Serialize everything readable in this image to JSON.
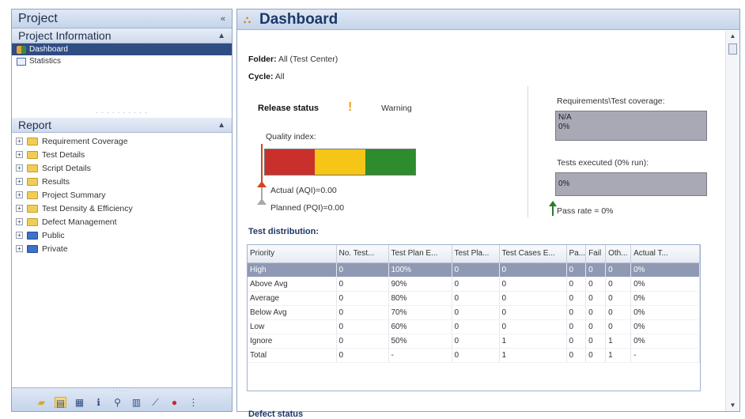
{
  "left_panel": {
    "title": "Project",
    "collapse_label": "«",
    "project_information": {
      "title": "Project Information",
      "collapse_label": "▲",
      "items": [
        {
          "label": "Dashboard",
          "icon": "dashboard-icon",
          "selected": true
        },
        {
          "label": "Statistics",
          "icon": "statistics-icon",
          "selected": false
        }
      ]
    },
    "report": {
      "title": "Report",
      "collapse_label": "▲",
      "items": [
        {
          "label": "Requirement Coverage",
          "icon": "folder-icon"
        },
        {
          "label": "Test Details",
          "icon": "folder-icon"
        },
        {
          "label": "Script Details",
          "icon": "folder-icon"
        },
        {
          "label": "Results",
          "icon": "folder-icon"
        },
        {
          "label": "Project Summary",
          "icon": "folder-icon"
        },
        {
          "label": "Test Density & Efficiency",
          "icon": "folder-icon"
        },
        {
          "label": "Defect Management",
          "icon": "folder-icon"
        },
        {
          "label": "Public",
          "icon": "blue-folder-icon"
        },
        {
          "label": "Private",
          "icon": "blue-folder-icon"
        }
      ]
    },
    "toolbar_icons": [
      "folder-icon",
      "dashboard-icon",
      "save-icon",
      "info-icon",
      "pin-icon",
      "grid-icon",
      "chart-icon",
      "bug-icon",
      "more-icon"
    ]
  },
  "dashboard": {
    "title": "Dashboard",
    "folder_label": "Folder:",
    "folder_value": "All (Test Center)",
    "cycle_label": "Cycle:",
    "cycle_value": "All",
    "release_status_label": "Release status",
    "release_status_icon": "!",
    "release_status_value": "Warning",
    "quality_index_label": "Quality index:",
    "quality_colors": [
      "#c9302c",
      "#f5c518",
      "#2e8b2e"
    ],
    "actual_label": "Actual (AQI)=0.00",
    "planned_label": "Planned (PQI)=0.00",
    "coverage_label": "Requirements\\Test coverage:",
    "coverage_box_line1": "N/A",
    "coverage_box_line2": "0%",
    "tests_executed_label": "Tests executed (0% run):",
    "tests_executed_box": "0%",
    "pass_rate_label": "Pass rate = 0%",
    "test_distribution_title": "Test distribution:",
    "defect_status_title": "Defect status"
  },
  "table": {
    "columns": [
      "Priority",
      "No. Test...",
      "Test Plan E...",
      "Test Pla...",
      "Test Cases E...",
      "Pa...",
      "Fail",
      "Oth...",
      "Actual T..."
    ],
    "rows": [
      [
        "High",
        "0",
        "100%",
        "0",
        "0",
        "0",
        "0",
        "0",
        "0%"
      ],
      [
        "Above Avg",
        "0",
        "90%",
        "0",
        "0",
        "0",
        "0",
        "0",
        "0%"
      ],
      [
        "Average",
        "0",
        "80%",
        "0",
        "0",
        "0",
        "0",
        "0",
        "0%"
      ],
      [
        "Below Avg",
        "0",
        "70%",
        "0",
        "0",
        "0",
        "0",
        "0",
        "0%"
      ],
      [
        "Low",
        "0",
        "60%",
        "0",
        "0",
        "0",
        "0",
        "0",
        "0%"
      ],
      [
        "Ignore",
        "0",
        "50%",
        "0",
        "1",
        "0",
        "0",
        "1",
        "0%"
      ],
      [
        "Total",
        "0",
        "-",
        "0",
        "1",
        "0",
        "0",
        "1",
        "-"
      ]
    ],
    "selected_row": 0
  }
}
